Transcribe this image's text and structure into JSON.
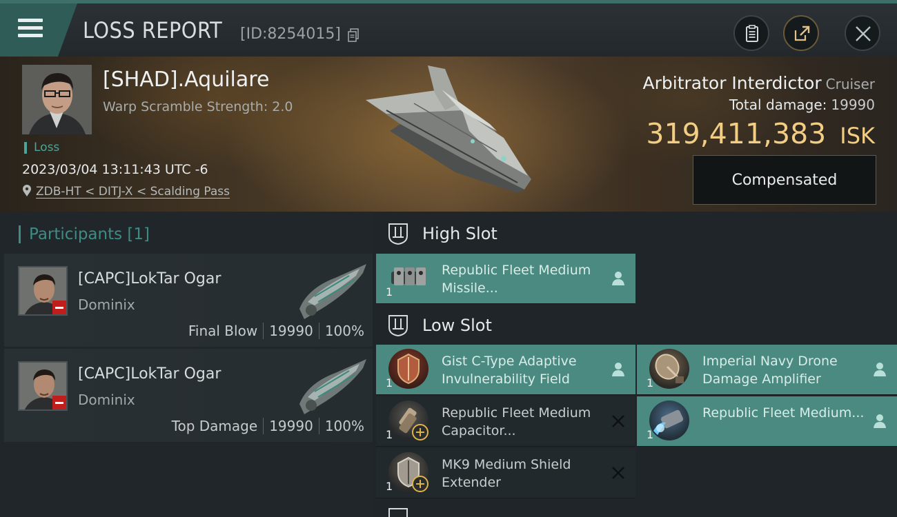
{
  "header": {
    "title": "LOSS REPORT",
    "report_id": "[ID:8254015]"
  },
  "victim": {
    "name": "[SHAD].Aquilare",
    "warp_scramble": "Warp Scramble Strength: 2.0",
    "status": "Loss",
    "datetime": "2023/03/04 13:11:43 UTC -6",
    "location": "ZDB-HT < DITJ-X < Scalding Pass",
    "ship_name": "Arbitrator Interdictor",
    "ship_class": "Cruiser",
    "total_damage_label": "Total damage:",
    "total_damage": "19990",
    "isk_value": "319,411,383",
    "isk_unit": "ISK",
    "compensated_label": "Compensated"
  },
  "participants": {
    "title": "Participants [1]",
    "cards": [
      {
        "name": "[CAPC]LokTar Ogar",
        "ship": "Dominix",
        "role": "Final Blow",
        "damage": "19990",
        "percent": "100%"
      },
      {
        "name": "[CAPC]LokTar Ogar",
        "ship": "Dominix",
        "role": "Top Damage",
        "damage": "19990",
        "percent": "100%"
      }
    ]
  },
  "slots": {
    "high": {
      "label": "High Slot",
      "modules": [
        {
          "name": "Republic Fleet Medium Missile...",
          "qty": "1",
          "state": "fitted",
          "icon": "missile-launcher-icon"
        }
      ]
    },
    "low": {
      "label": "Low Slot",
      "modules": [
        {
          "name": "Gist C-Type Adaptive Invulnerability Field",
          "qty": "1",
          "state": "fitted",
          "icon": "shield-hardener-icon"
        },
        {
          "name": "Imperial Navy Drone Damage Amplifier",
          "qty": "1",
          "state": "fitted",
          "icon": "drone-amplifier-icon"
        },
        {
          "name": "Republic Fleet Medium Capacitor...",
          "qty": "1",
          "state": "destroyed",
          "icon": "capacitor-battery-icon"
        },
        {
          "name": "Republic Fleet Medium...",
          "qty": "1",
          "state": "fitted",
          "icon": "capacitor-booster-icon"
        },
        {
          "name": "MK9 Medium Shield Extender",
          "qty": "1",
          "state": "destroyed",
          "icon": "shield-extender-icon"
        }
      ]
    }
  },
  "colors": {
    "accent": "#4a8a81",
    "isk": "#f2cd84",
    "loss": "#4fa49a",
    "minus_badge": "#c01d1d"
  }
}
